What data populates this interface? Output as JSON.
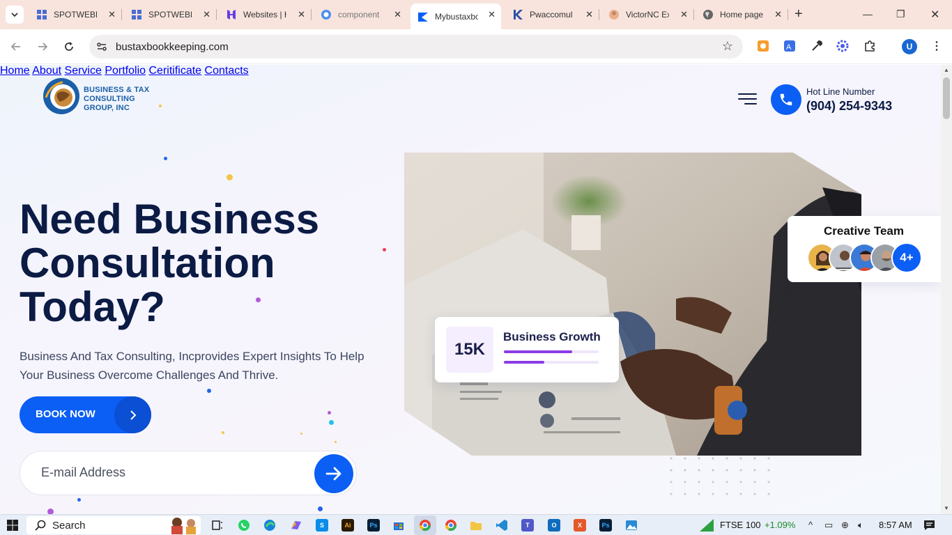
{
  "browser": {
    "tabs": [
      {
        "title": "SPOTWEBDI",
        "icon": "spotweb-grid-icon"
      },
      {
        "title": "SPOTWEBDI",
        "icon": "spotweb-grid-icon"
      },
      {
        "title": "Websites | H",
        "icon": "hostinger-icon"
      },
      {
        "title": "component",
        "icon": "component-icon"
      },
      {
        "title": "Mybustaxbo",
        "icon": "mybustax-icon",
        "active": true
      },
      {
        "title": "Pwaccomult",
        "icon": "pwacc-icon"
      },
      {
        "title": "VictorNC Ex",
        "icon": "victornc-icon"
      },
      {
        "title": "Home page",
        "icon": "globe-icon"
      }
    ],
    "url": "bustaxbookkeeping.com",
    "profile_initial": "U"
  },
  "site": {
    "logo_lines": [
      "BUSINESS & TAX",
      "CONSULTING",
      "GROUP, INC"
    ],
    "nav": [
      "Home",
      "About",
      "Service",
      "Portfolio",
      "Ceritificate",
      "Contacts"
    ],
    "hotline_label": "Hot Line Number",
    "hotline_number": "(904) 254-9343"
  },
  "hero": {
    "title_lines": [
      "Need Business",
      "Consultation",
      "Today?"
    ],
    "description": "Business And Tax Consulting, Incprovides Expert Insights To Help Your Business Overcome Challenges And Thrive.",
    "book_button": "BOOK NOW",
    "email_placeholder": "E-mail Address"
  },
  "growth_card": {
    "value": "15K",
    "label": "Business Growth",
    "bar1_fill": 0.72,
    "bar2_fill": 0.43
  },
  "team_card": {
    "title": "Creative Team",
    "more": "4+"
  },
  "colors": {
    "primary": "#0b5ff5",
    "navy": "#0b1b44",
    "purple": "#8b3be6"
  },
  "taskbar": {
    "search_label": "Search",
    "ftse_label": "FTSE 100",
    "ftse_change": "+1.09%",
    "time": "8:57 AM"
  }
}
